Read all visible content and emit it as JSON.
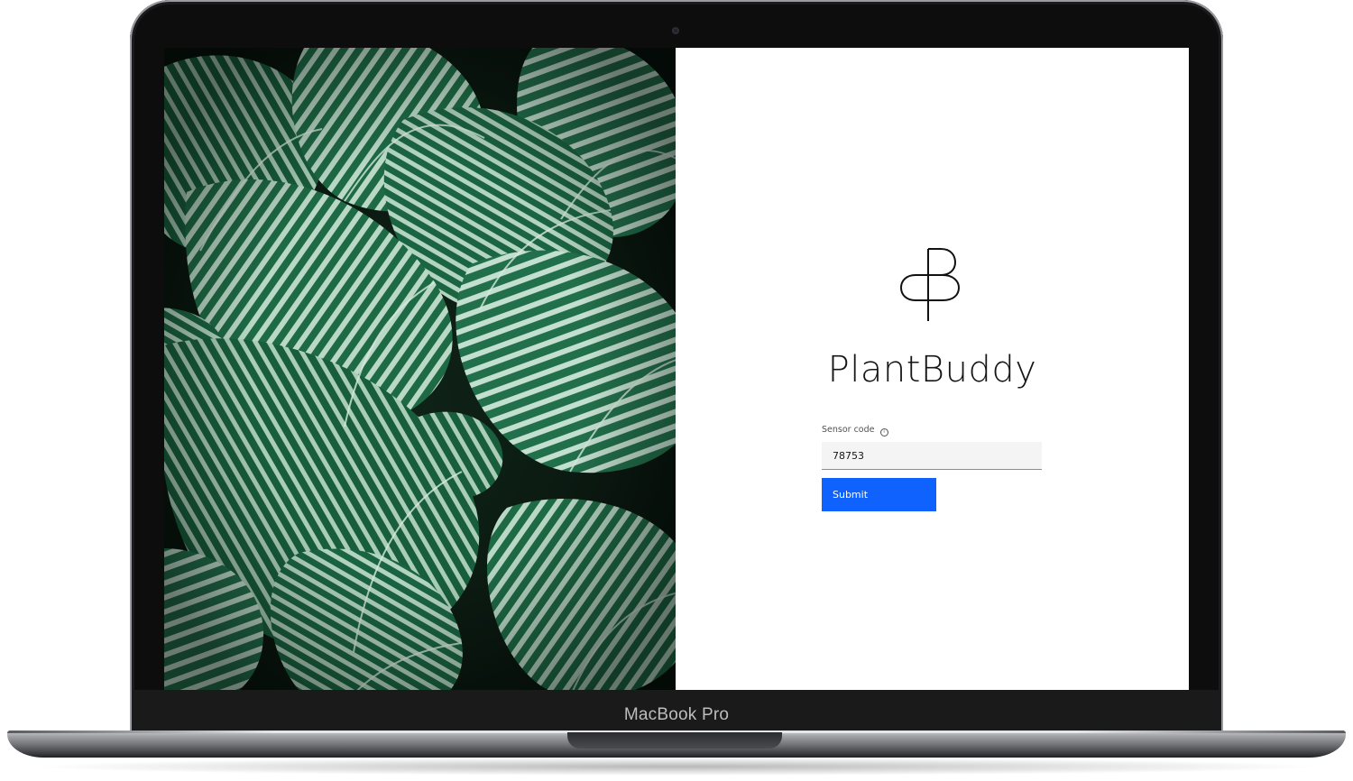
{
  "device": {
    "brand_label": "MacBook Pro"
  },
  "app": {
    "title": "PlantBuddy",
    "logo_icon": "plantbuddy-logo-icon"
  },
  "form": {
    "sensor_label": "Sensor code",
    "info_icon": "info-icon",
    "sensor_value": "78753",
    "submit_label": "Submit"
  },
  "colors": {
    "primary_button": "#0f62fe",
    "input_background": "#f4f4f4",
    "leaf_green": "#1f6b48",
    "title_text": "#161616"
  }
}
